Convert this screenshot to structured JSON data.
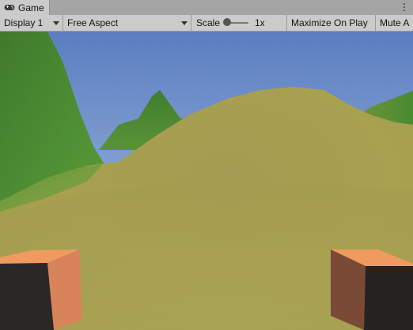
{
  "window": {
    "tab_label": "Game",
    "tab_icon": "gamepad-icon",
    "menu_icon": "more-options-icon"
  },
  "toolbar": {
    "display_label": "Display 1",
    "aspect_label": "Free Aspect",
    "scale_label": "Scale",
    "scale_value": "1x",
    "scale_fraction": 0.0,
    "maximize_label": "Maximize On Play",
    "mute_label": "Mute A"
  },
  "colors": {
    "sky_top": "#5b7fc0",
    "sky_bottom": "#bcd1ea",
    "near_hill": "#a8a050",
    "far_hill_green": "#4c8a32",
    "hand_orange": "#e8935c",
    "hand_dark": "#2b2626"
  }
}
